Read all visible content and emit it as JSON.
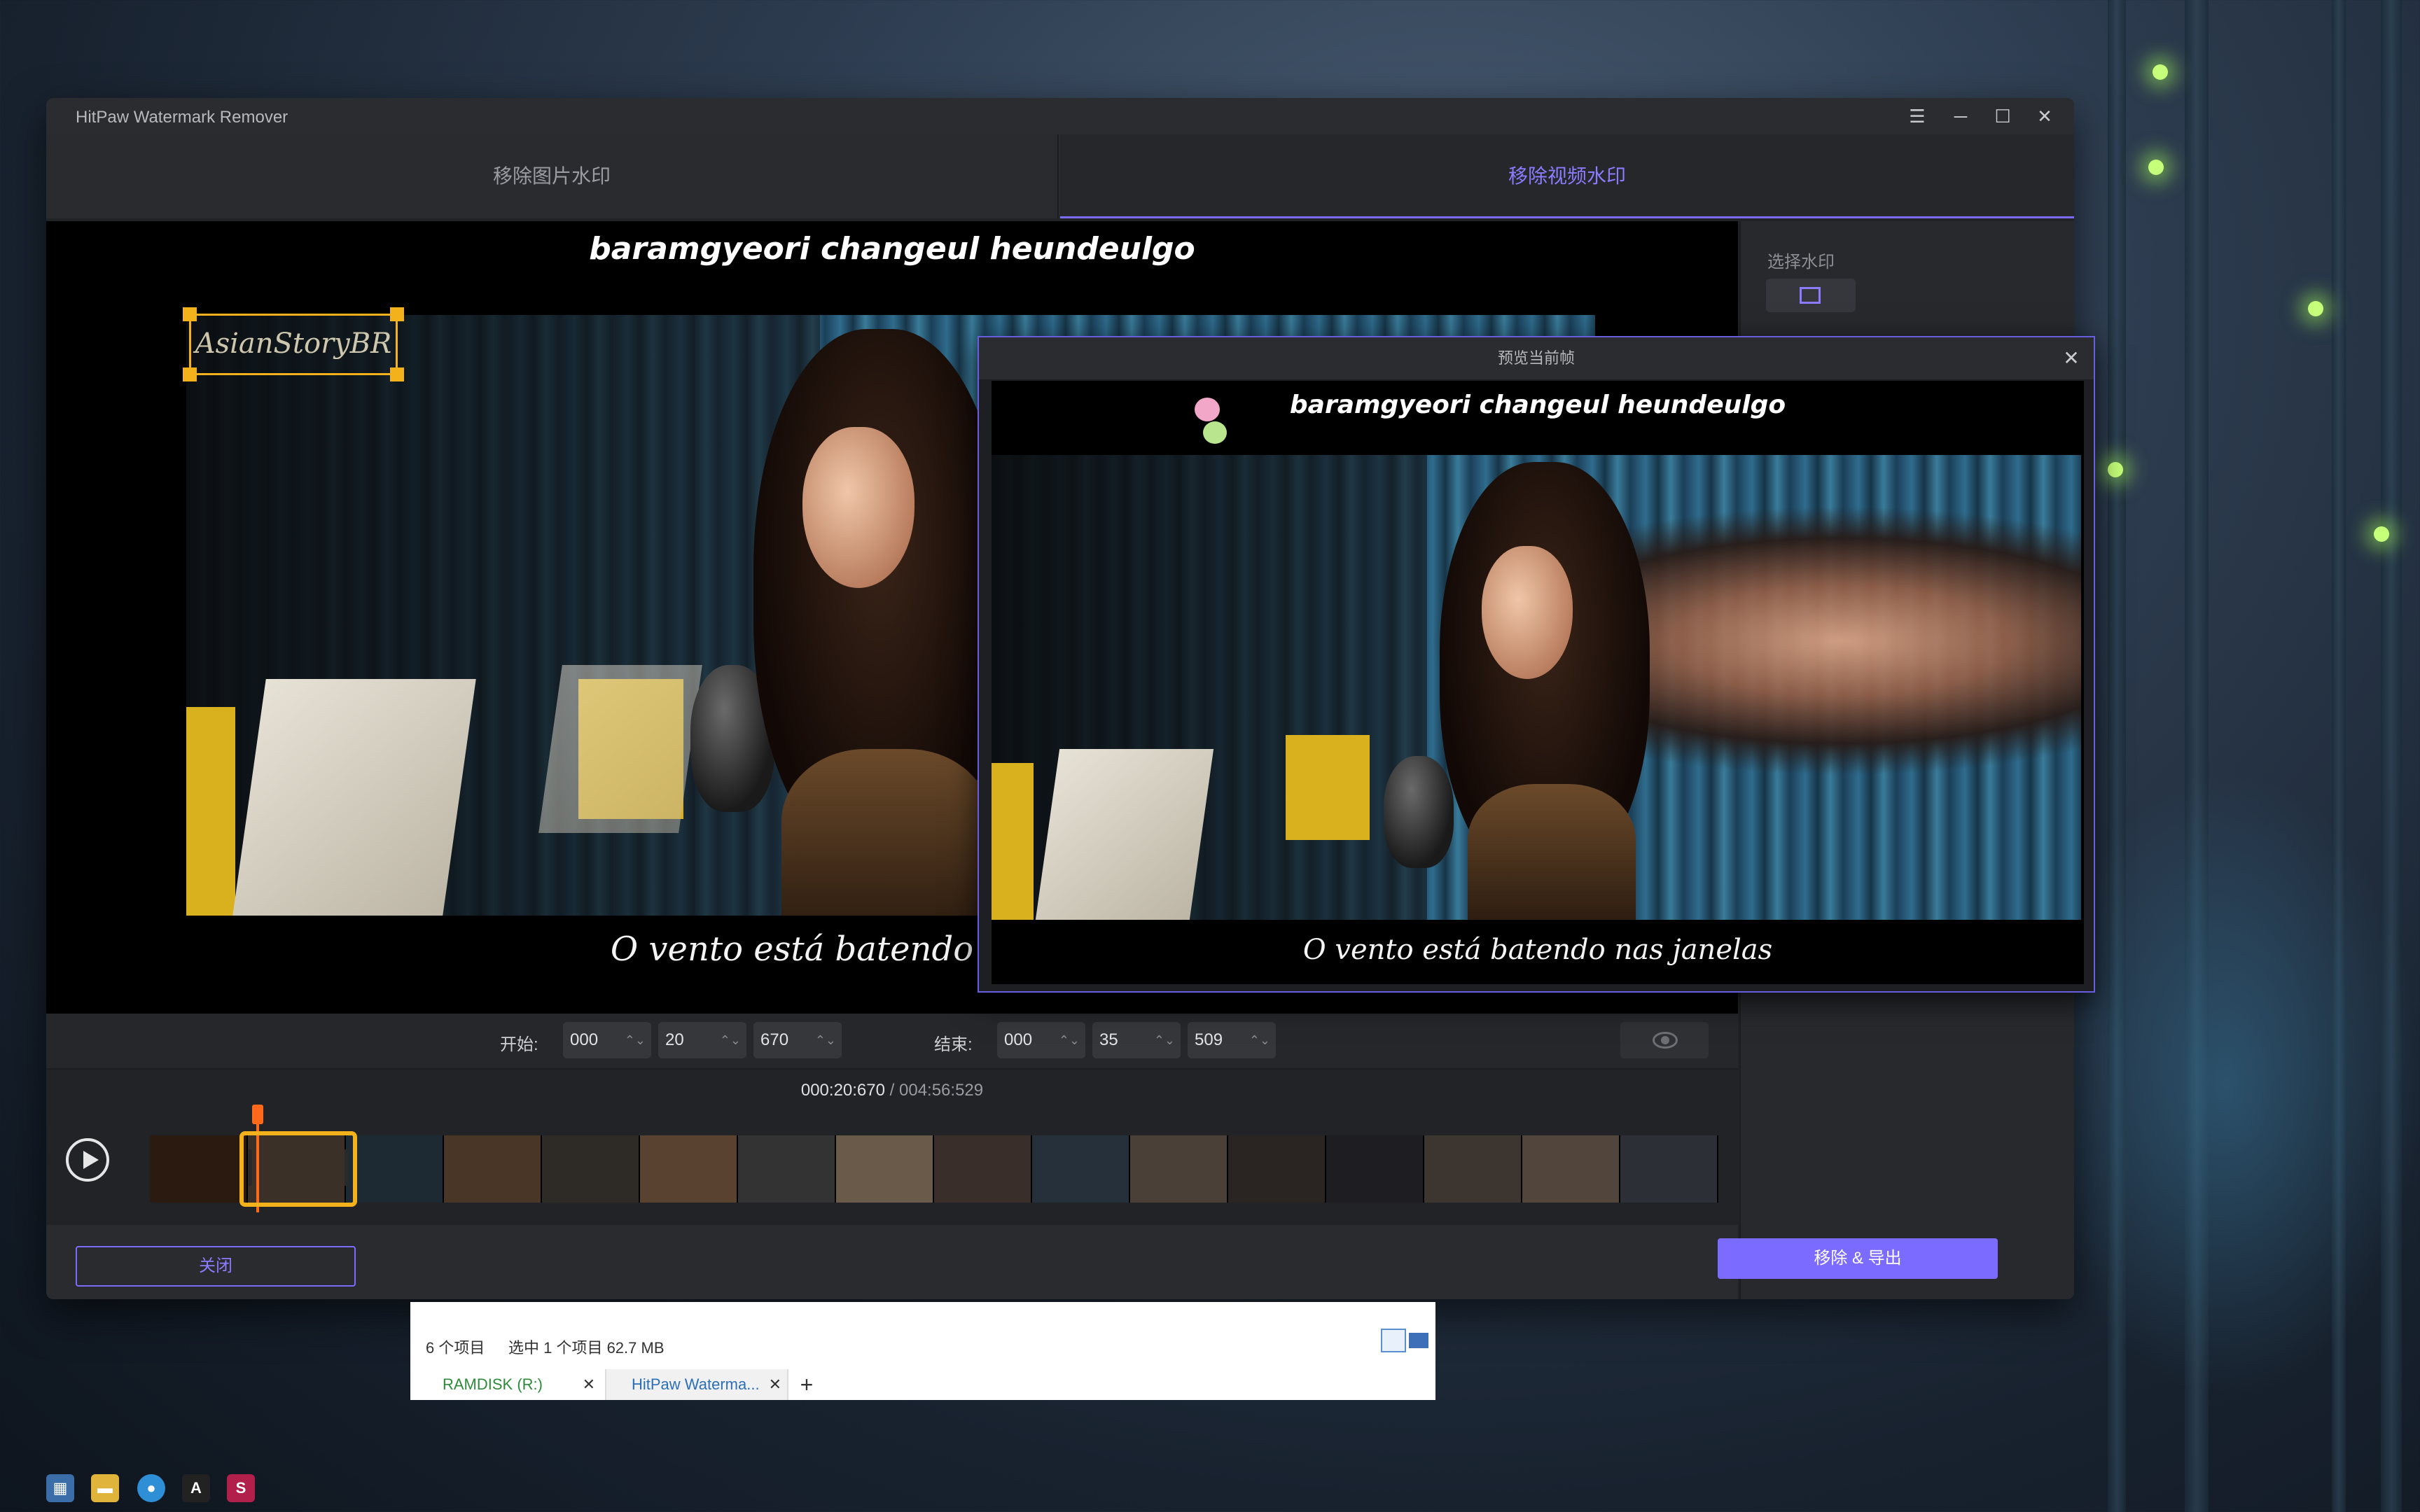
{
  "app": {
    "title": "HitPaw Watermark Remover"
  },
  "window_controls": {
    "menu": "☰",
    "minimize": "─",
    "maximize": "☐",
    "close": "✕"
  },
  "tabs": [
    {
      "label": "移除图片水印",
      "active": false
    },
    {
      "label": "移除视频水印",
      "active": true
    }
  ],
  "video": {
    "subtitle_top": "baramgyeori changeul heundeulgo",
    "subtitle_bottom": "O vento está batendo nas janelas",
    "watermark_text": "AsianStoryBR"
  },
  "side_panel": {
    "select_label": "选择水印",
    "select_tool_icon": "rectangle-select-icon"
  },
  "time_range": {
    "start_label": "开始:",
    "start": [
      "000",
      "20",
      "670"
    ],
    "end_label": "结束:",
    "end": [
      "000",
      "35",
      "509"
    ],
    "preview_toggle_icon": "eye-icon"
  },
  "playback": {
    "current": "000:20:670",
    "separator": " / ",
    "total": "004:56:529"
  },
  "footer": {
    "close_label": "关闭",
    "export_label": "移除 & 导出"
  },
  "preview_dialog": {
    "title": "预览当前帧",
    "subtitle_top": "baramgyeori changeul heundeulgo",
    "subtitle_bottom": "O vento está batendo nas janelas"
  },
  "explorer": {
    "item_count": "6 个项目",
    "selected": "选中 1 个项目  62.7 MB",
    "tabs": [
      {
        "label": "RAMDISK (R:)"
      },
      {
        "label": "HitPaw Waterma..."
      }
    ],
    "new_tab": "+"
  },
  "taskbar": {
    "icons": [
      "app-grid-icon",
      "folder-icon",
      "browser-icon",
      "reader-icon",
      "hitpaw-icon"
    ]
  },
  "colors": {
    "accent": "#7c6bff",
    "selection": "#f3b21b",
    "playhead": "#ff6a1a"
  }
}
